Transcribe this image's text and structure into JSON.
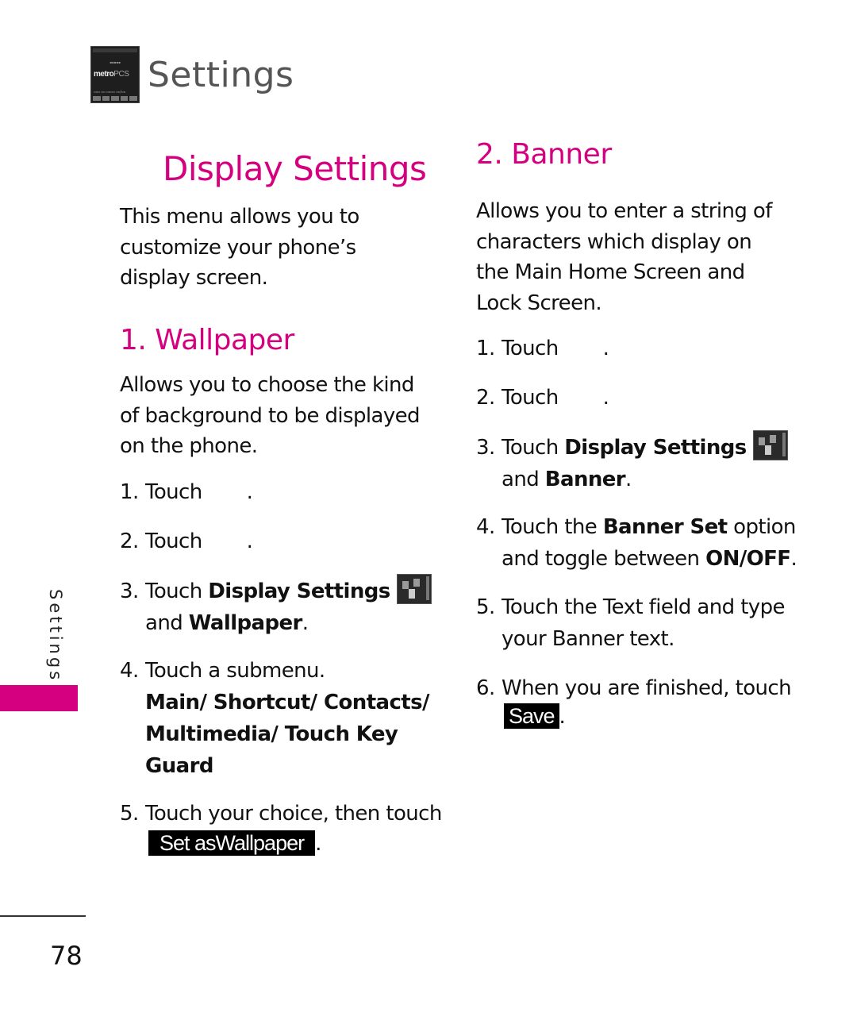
{
  "header": {
    "title": "Settings",
    "thumbnail": {
      "icon": "phone-home-screen-icon",
      "logo_text_bold": "metro",
      "logo_text_light": "PCS"
    }
  },
  "main_heading": "Display Settings",
  "intro": "This menu allows you to customize your phone’s display screen.",
  "wallpaper": {
    "heading": "1. Wallpaper",
    "description": "Allows you to choose the kind of background to be displayed on the phone.",
    "steps": [
      {
        "num": "1.",
        "text": "Touch",
        "suffix": "."
      },
      {
        "num": "2.",
        "text": "Touch",
        "suffix": "."
      },
      {
        "num": "3.",
        "pre": "Touch ",
        "bold": "Display Settings",
        "line2_pre": "and ",
        "line2_bold": "Wallpaper",
        "line2_suffix": ".",
        "icon": "display-settings-icon"
      },
      {
        "num": "4.",
        "text": "Touch a submenu.",
        "options": "Main/ Shortcut/ Contacts/ Multimedia/ Touch Key Guard"
      },
      {
        "num": "5.",
        "text": "Touch your choice, then touch",
        "button": "Set asWallpaper",
        "suffix": "."
      }
    ]
  },
  "banner": {
    "heading": "2. Banner",
    "description": "Allows you to enter a string of characters which display on the Main Home Screen and Lock Screen.",
    "steps": [
      {
        "num": "1.",
        "text": "Touch",
        "suffix": "."
      },
      {
        "num": "2.",
        "text": "Touch",
        "suffix": "."
      },
      {
        "num": "3.",
        "pre": "Touch ",
        "bold": "Display Settings",
        "line2_pre": "and ",
        "line2_bold": "Banner",
        "line2_suffix": ".",
        "icon": "display-settings-icon"
      },
      {
        "num": "4.",
        "pre": "Touch the ",
        "bold": "Banner Set",
        "post": " option",
        "line2_pre": "and toggle between ",
        "line2_bold": "ON/OFF",
        "line2_suffix": "."
      },
      {
        "num": "5.",
        "text": "Touch the Text field and type",
        "line2": "your Banner text."
      },
      {
        "num": "6.",
        "text": "When you are finished, touch",
        "button": "Save",
        "suffix": "."
      }
    ]
  },
  "side_tab": {
    "label": "Settings",
    "color": "#d5007f"
  },
  "page_number": "78",
  "colors": {
    "accent": "#d5007f",
    "text": "#111111",
    "header_gray": "#555555"
  }
}
